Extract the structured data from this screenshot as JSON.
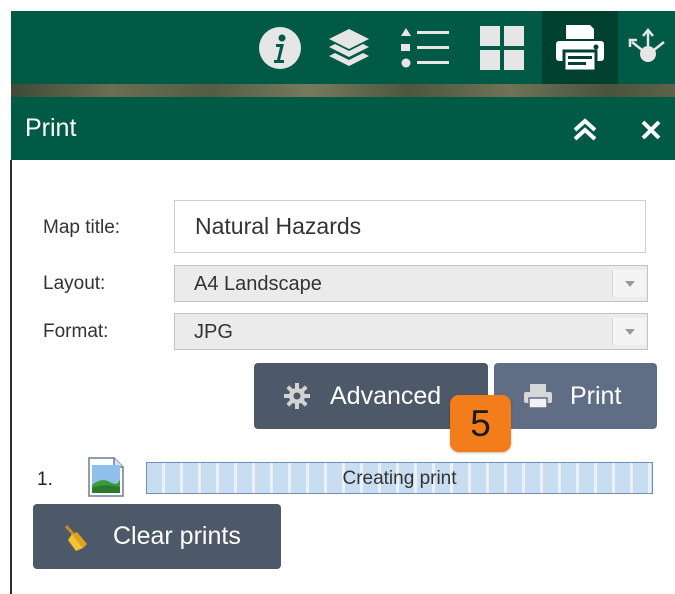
{
  "toolbar": {
    "buttons": [
      {
        "id": "info",
        "icon": "info-icon"
      },
      {
        "id": "layers",
        "icon": "layers-icon"
      },
      {
        "id": "legend",
        "icon": "legend-list-icon"
      },
      {
        "id": "basemap",
        "icon": "grid-icon"
      },
      {
        "id": "print",
        "icon": "printer-icon",
        "active": true
      },
      {
        "id": "share",
        "icon": "share-icon"
      }
    ]
  },
  "panel": {
    "title": "Print",
    "collapse_icon": "chevron-double-up-icon",
    "close_icon": "close-icon"
  },
  "form": {
    "map_title_label": "Map title:",
    "map_title_value": "Natural Hazards",
    "layout_label": "Layout:",
    "layout_value": "A4 Landscape",
    "format_label": "Format:",
    "format_value": "JPG"
  },
  "buttons": {
    "advanced_label": "Advanced",
    "print_label": "Print",
    "clear_label": "Clear prints"
  },
  "badge": {
    "text": "5",
    "color": "#f27d1a"
  },
  "prints": [
    {
      "number": "1.",
      "status": "Creating print"
    }
  ],
  "colors": {
    "header": "#005a46",
    "button": "#4d5868",
    "print_button": "#5f6e85"
  }
}
